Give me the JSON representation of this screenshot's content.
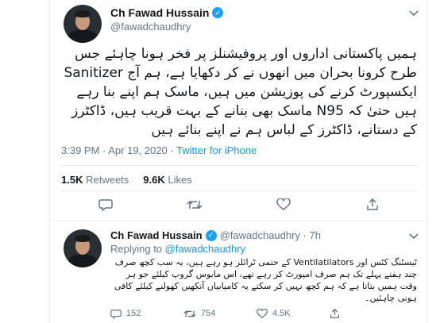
{
  "main_tweet": {
    "display_name": "Ch Fawad Hussain",
    "verified_mark": "✓",
    "handle": "@fawadchaudhry",
    "text": "ہمیں پاکستانی اداروں اور پروفیشنلز پر فخر ہونا چاہئے جس طرح کرونا بحران میں انھوں نے کر دکھایا ہے، ہم آج Sanitizer ایکسپورٹ کرنے کی پوزیشن میں ہیں، ماسک ہم اپنے بنا رہے ہیں حتیٰ کہ N95 ماسک بھی بنانے کے بہت قریب ہیں، ڈاکٹرز کے دستانے، ڈاکٹرز کے لباس ہم نے اپنے بنائے ہیں",
    "time": "3:39 PM · Apr 19, 2020 · ",
    "source": "Twitter for iPhone",
    "retweets_count": "1.5K",
    "retweets_label": "Retweets",
    "likes_count": "9.6K",
    "likes_label": "Likes"
  },
  "reply": {
    "display_name": "Ch Fawad Hussain",
    "verified_mark": "✓",
    "handle_time": "@fawadchaudhry · 7h",
    "replying_prefix": "Replying to ",
    "replying_to": "@fawadchaudhry",
    "text": "ٹیسٹنگ کٹس اور Ventilatilators کے حتمی ٹرائلز ہو رہے ہیں، یہ سب کچھ صرف چند ہفتے پہلے تک ہم صرف امپورٹ کر رہے تھے، اس مایوس گروپ کیلئے جو ہر وقت ہمیں بتاتا ہے کہ ہم کچھ نہیں کر سکتے یہ کامیابیاں آنکھیں کھولنے کیلئے کافی ہونی چاہئیں۔",
    "replies": "152",
    "retweets": "754",
    "likes": "4.5K"
  },
  "colors": {
    "accent": "#1da1f2",
    "link": "#1b95e0",
    "muted": "#657786",
    "border": "#e6ecf0"
  },
  "icons": [
    "verified-icon",
    "caret-down-icon",
    "reply-icon",
    "retweet-icon",
    "like-icon",
    "share-icon"
  ]
}
